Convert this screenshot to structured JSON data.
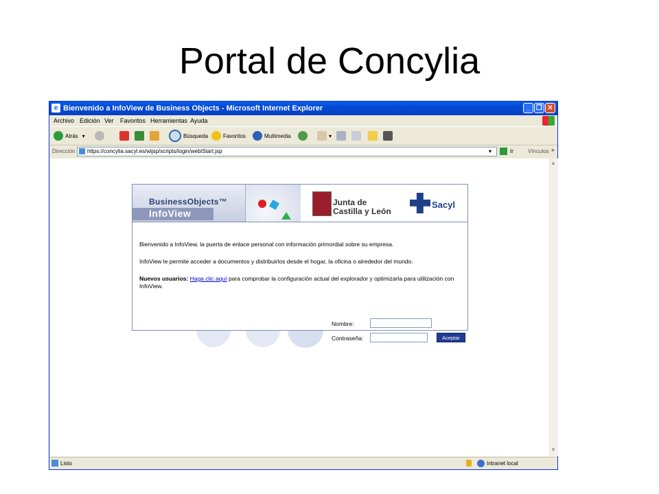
{
  "slide": {
    "title": "Portal de Concylia"
  },
  "window": {
    "title": "Bienvenido a InfoView de Business Objects - Microsoft Internet Explorer",
    "menu": [
      "Archivo",
      "Edición",
      "Ver",
      "Favoritos",
      "Herramientas",
      "Ayuda"
    ],
    "toolbar": {
      "back": "Atrás",
      "search": "Búsqueda",
      "favorites": "Favoritos",
      "multimedia": "Multimedia"
    },
    "address": {
      "label": "Dirección",
      "url": "https://concylia.sacyl.es/wijsp/scripts/login/webiStart.jsp",
      "go": "Ir",
      "links": "Vínculos"
    },
    "status": {
      "text": "Listo",
      "zone": "Intranet local"
    }
  },
  "page": {
    "banner": {
      "bo": "BusinessObjects™",
      "infoview": "InfoView",
      "junta_line1": "Junta de",
      "junta_line2": "Castilla y León",
      "sacyl": "Sacyl"
    },
    "welcome": "Bienvenido a InfoView, la puerta de enlace personal con información primordial sobre su empresa.",
    "access": "InfoView le permite acceder a documentos y distribuirlos desde el hogar, la oficina o alrededor del mundo.",
    "new_users_label": "Nuevos usuarios:",
    "new_users_link": "Haga clic aquí",
    "new_users_text": "para comprobar la configuración actual del explorador y optimizarla para utilización con InfoView.",
    "form": {
      "name_label": "Nombre:",
      "password_label": "Contraseña:",
      "submit": "Aceptar"
    }
  }
}
